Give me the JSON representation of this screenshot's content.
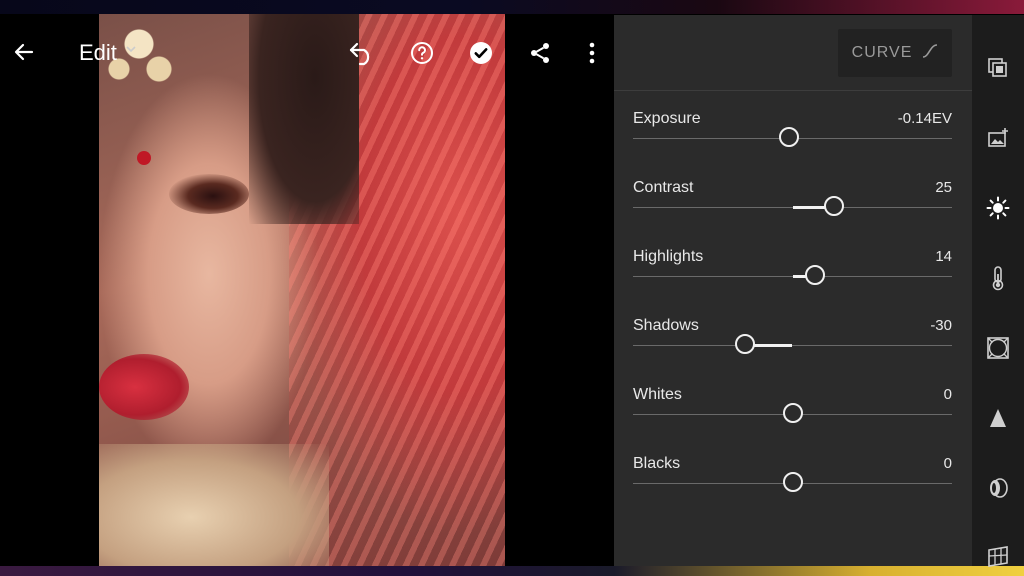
{
  "toolbar": {
    "edit_label": "Edit"
  },
  "panel": {
    "curve_label": "CURVE",
    "sliders": [
      {
        "label": "Exposure",
        "value": "-0.14EV",
        "level": 0.49
      },
      {
        "label": "Contrast",
        "value": "25",
        "level": 0.63
      },
      {
        "label": "Highlights",
        "value": "14",
        "level": 0.57
      },
      {
        "label": "Shadows",
        "value": "-30",
        "level": 0.35
      },
      {
        "label": "Whites",
        "value": "0",
        "level": 0.5
      },
      {
        "label": "Blacks",
        "value": "0",
        "level": 0.5
      }
    ]
  },
  "rail": {
    "icons": [
      "presets-icon",
      "selective-edit-icon",
      "light-icon",
      "color-temperature-icon",
      "vignette-icon",
      "detail-icon",
      "optics-icon",
      "geometry-icon"
    ]
  },
  "colors": {
    "panel_bg": "#2b2b2b",
    "rail_bg": "#1c1c1c",
    "slider_fill": "#f2f2f2",
    "slider_track": "#6a6a6a"
  }
}
